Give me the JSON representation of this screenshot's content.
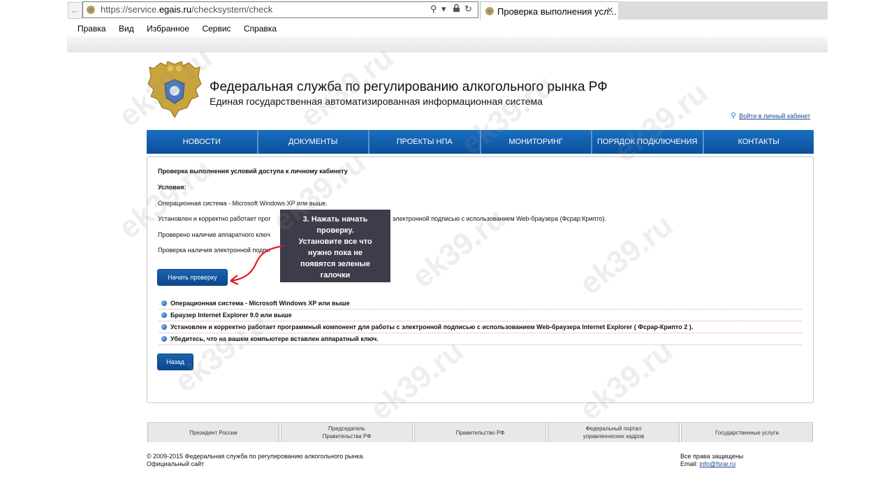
{
  "browser": {
    "url_prefix": "https://service.",
    "url_domain": "egais.ru",
    "url_path": "/checksystem/check",
    "tab_title": "Проверка выполнения усл...",
    "menu": [
      "Правка",
      "Вид",
      "Избранное",
      "Сервис",
      "Справка"
    ]
  },
  "header": {
    "title": "Федеральная служба по регулированию алкогольного рынка РФ",
    "subtitle": "Единая государственная автоматизированная информационная система",
    "login_link": "Войти в личный кабинет"
  },
  "nav": [
    "НОВОСТИ",
    "ДОКУМЕНТЫ",
    "ПРОЕКТЫ НПА",
    "МОНИТОРИНГ",
    "ПОРЯДОК ПОДКЛЮЧЕНИЯ",
    "КОНТАКТЫ"
  ],
  "content": {
    "heading": "Проверка выполнения условий доступа к личному кабинету",
    "conditions_label": "Условия:",
    "conditions": [
      "Операционная система - Microsoft Windows XP или выше.",
      "Установлен и корректно работает прог",
      "электронной подписью с использованием Web-браузера (Фсрар:Крипто).",
      "Проверено наличие аппаратного ключ",
      "Проверка наличия электронной подпи"
    ],
    "start_button": "Начать проверку",
    "checks": [
      "Операционная система - Microsoft Windows XP или выше",
      "Браузер Internet Explorer 9.0 или выше",
      "Установлен и корректно работает программный компонент для работы с электронной подписью с использованием Web-браузера Internet Explorer ( Фсрар-Крипто 2 ).",
      "Убедитесь, что на вашем компьютере вставлен аппаратный ключ."
    ],
    "back_button": "Назад"
  },
  "callout": {
    "lines": [
      "3. Нажать  начать",
      "проверку.",
      "Установите  все что",
      "нужно пока  не",
      "появятся зеленые",
      "галочки"
    ]
  },
  "footer": {
    "links": [
      "Президент России",
      "Председатель\nПравительства РФ",
      "Правительство РФ",
      "Федеральный портал\nуправленческих кадров",
      "Государственные услуги"
    ],
    "copyright_line1": "© 2009-2015 Федеральная служба по регулированию алкогольного рынка.",
    "copyright_line2": "Официальный сайт",
    "rights": "Все права защищены",
    "email_label": "Email: ",
    "email": "info@fsrar.ru"
  },
  "watermark": "ek39.ru",
  "colors": {
    "nav_blue": "#0a5aa8",
    "button_blue": "#0e55a0",
    "callout_bg": "#3c3c4a",
    "arrow_red": "#e0192a"
  }
}
